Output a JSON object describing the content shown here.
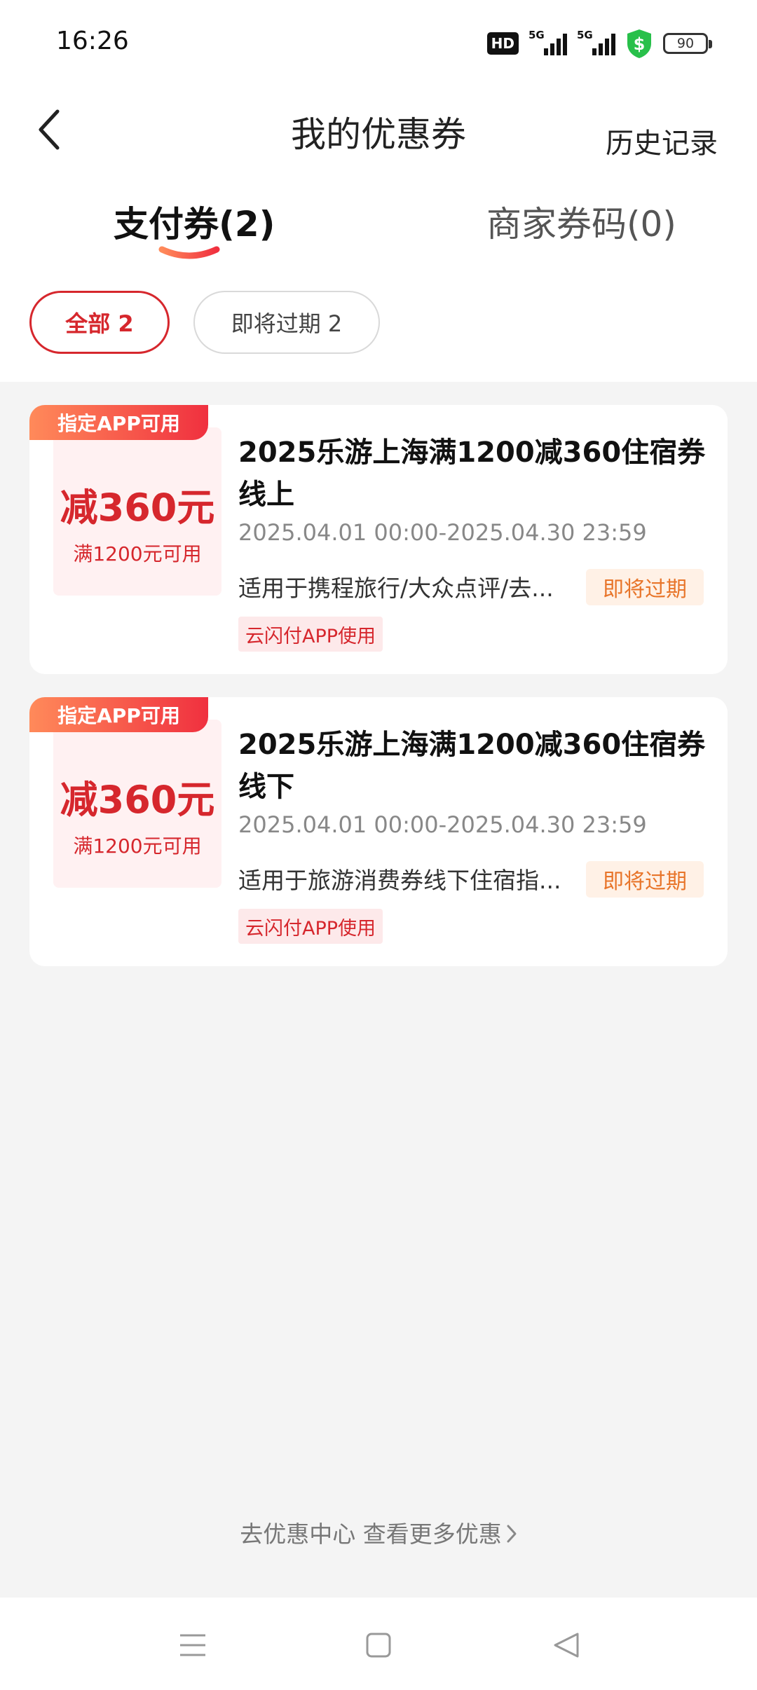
{
  "status_bar": {
    "time": "16:26",
    "hd_label": "HD",
    "signal1_label": "5G",
    "signal2_label": "5G",
    "battery": "90",
    "shield_symbol": "$"
  },
  "header": {
    "title": "我的优惠券",
    "history": "历史记录"
  },
  "tabs": [
    {
      "label": "支付券(2)",
      "active": true
    },
    {
      "label": "商家券码(0)",
      "active": false
    }
  ],
  "filters": [
    {
      "label": "全部 2",
      "selected": true
    },
    {
      "label": "即将过期 2",
      "selected": false
    }
  ],
  "coupons": [
    {
      "tag": "指定APP可用",
      "amount": "减360元",
      "condition": "满1200元可用",
      "title": "2025乐游上海满1200减360住宿券线上",
      "validity": "2025.04.01 00:00-2025.04.30 23:59",
      "description": "适用于携程旅行/大众点评/去...",
      "status": "即将过期",
      "usage": "云闪付APP使用"
    },
    {
      "tag": "指定APP可用",
      "amount": "减360元",
      "condition": "满1200元可用",
      "title": "2025乐游上海满1200减360住宿券线下",
      "validity": "2025.04.01 00:00-2025.04.30 23:59",
      "description": "适用于旅游消费券线下住宿指...",
      "status": "即将过期",
      "usage": "云闪付APP使用"
    }
  ],
  "footer": {
    "more_link": "去优惠中心 查看更多优惠"
  },
  "colors": {
    "accent": "#d6272d",
    "warning": "#e8752a",
    "background": "#f4f4f4"
  }
}
